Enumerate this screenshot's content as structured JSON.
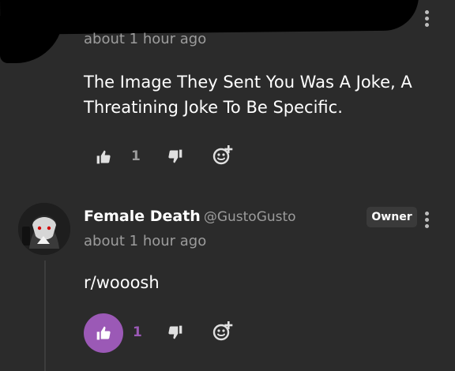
{
  "comments": [
    {
      "timestamp": "about 1 hour ago",
      "text": "The Image They Sent You Was A Joke, A Threatining Joke To Be Specific.",
      "like_count": "1",
      "liked": false
    },
    {
      "author_name": "Female Death",
      "author_handle": "@GustoGusto",
      "badge": "Owner",
      "timestamp": "about 1 hour ago",
      "text": "r/wooosh",
      "like_count": "1",
      "liked": true
    }
  ],
  "icons": {
    "like": "thumbs-up-icon",
    "dislike": "thumbs-down-icon",
    "react": "add-reaction-icon",
    "menu": "more-options-icon"
  },
  "colors": {
    "background": "#2b2b2b",
    "liked_accent": "#9b59b6",
    "muted_text": "#9c9c9c"
  }
}
